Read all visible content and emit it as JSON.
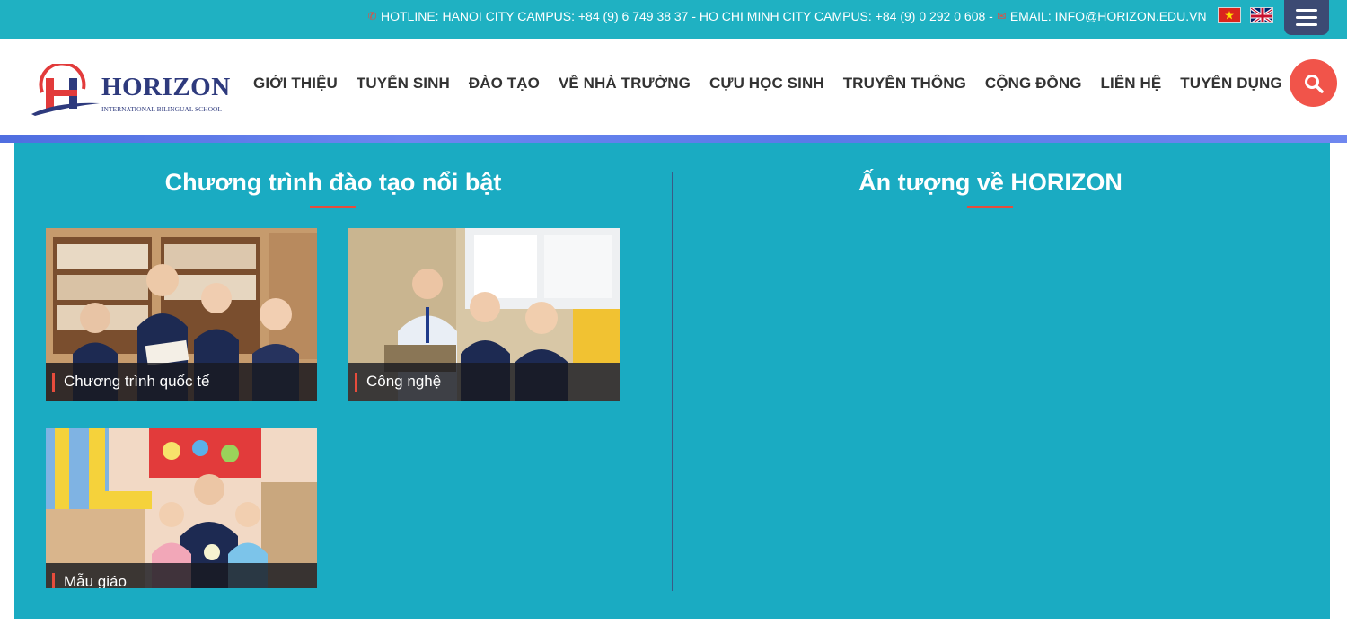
{
  "topbar": {
    "contact": "HOTLINE: HANOI CITY CAMPUS: +84 (9) 6 749 38 37 - HO CHI MINH CITY CAMPUS: +84 (9) 0 292 0 608 -",
    "email": "EMAIL: INFO@HORIZON.EDU.VN",
    "phone_icon": "phone-icon",
    "email_icon": "envelope-icon",
    "languages": [
      "vi",
      "en"
    ]
  },
  "logo": {
    "brand": "HORIZON",
    "tagline": "INTERNATIONAL BILINGUAL SCHOOL"
  },
  "nav": {
    "items": [
      "GIỚI THIỆU",
      "TUYỂN SINH",
      "ĐÀO TẠO",
      "VỀ NHÀ TRƯỜNG",
      "CỰU HỌC SINH",
      "TRUYỀN THÔNG",
      "CỘNG ĐỒNG",
      "LIÊN HỆ",
      "TUYỂN DỤNG"
    ]
  },
  "main": {
    "left_title": "Chương trình đào tạo nổi bật",
    "right_title": "Ấn tượng về HORIZON",
    "cards": [
      {
        "label": "Chương trình quốc tế"
      },
      {
        "label": "Công nghệ"
      },
      {
        "label": "Mẫu giáo"
      }
    ]
  },
  "colors": {
    "teal": "#1aabc2",
    "accent": "#e74c3c",
    "navy": "#2e3a7d"
  }
}
